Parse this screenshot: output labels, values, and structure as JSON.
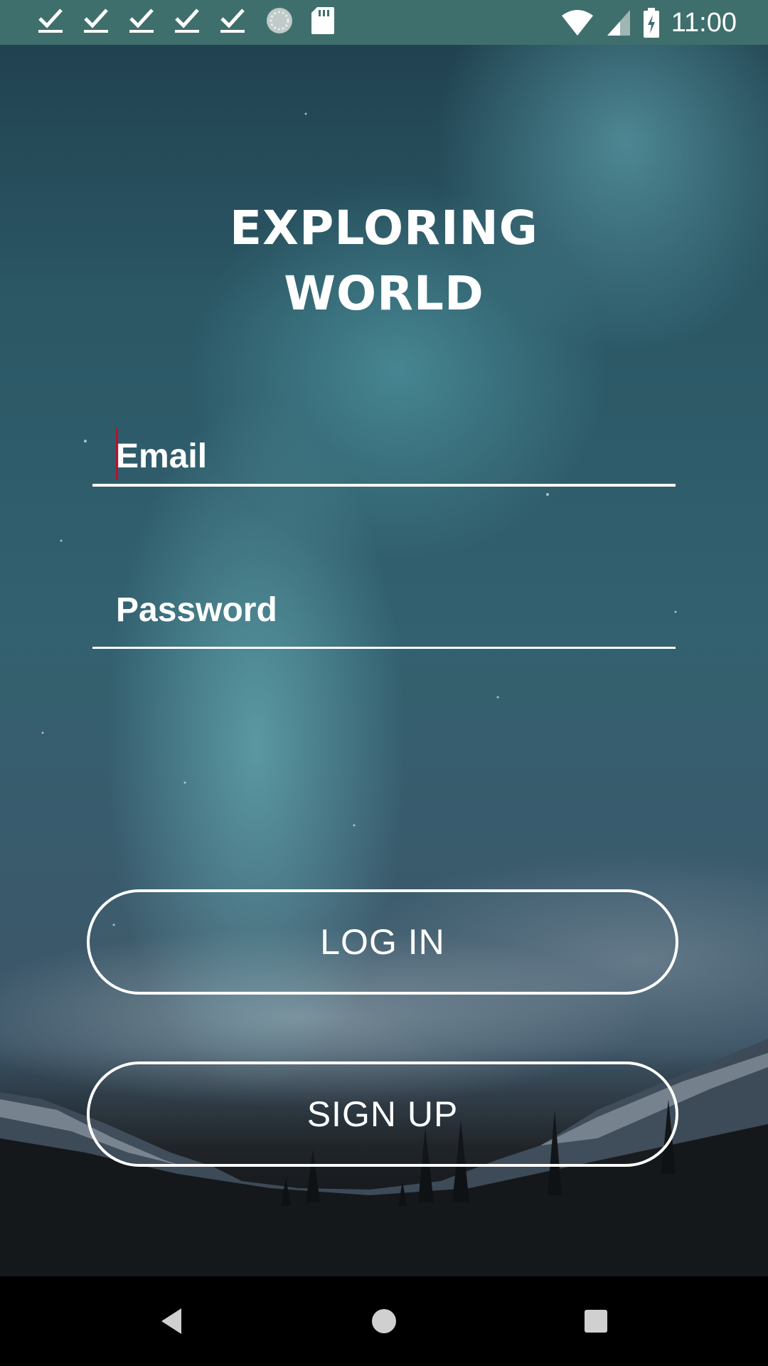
{
  "status_bar": {
    "notification_icons": [
      "check-download-icon",
      "check-download-icon",
      "check-download-icon",
      "check-download-icon",
      "check-download-icon",
      "sync-circle-icon",
      "sd-card-icon"
    ],
    "wifi_icon": "wifi-icon",
    "signal_icon": "cell-signal-icon",
    "battery_icon": "battery-charging-icon",
    "time": "11:00",
    "background_color": "#3f6f6c"
  },
  "app": {
    "title_line1": "EXPLORING",
    "title_line2": "WORLD"
  },
  "form": {
    "email_hint": "Email",
    "password_hint": "Password",
    "cursor_color": "#b4122c"
  },
  "buttons": {
    "login_label": "LOG IN",
    "signup_label": "SIGN UP"
  },
  "nav_bar": {
    "back_icon": "back-triangle-icon",
    "home_icon": "home-circle-icon",
    "recents_icon": "recents-square-icon"
  }
}
